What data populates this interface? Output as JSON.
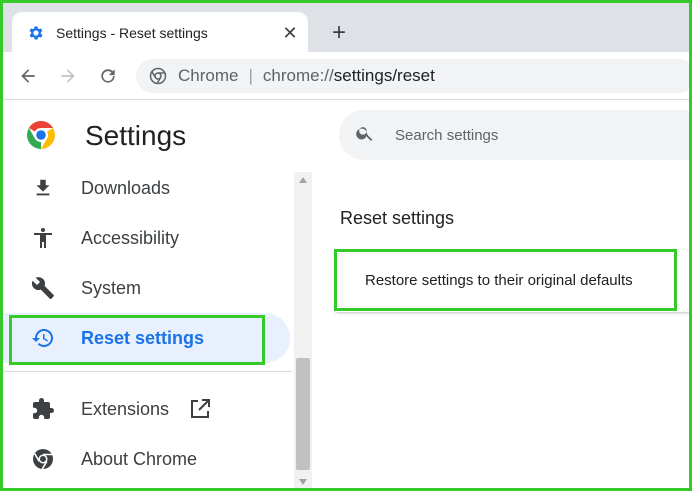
{
  "tab": {
    "title": "Settings - Reset settings",
    "close_glyph": "✕",
    "favicon": "gear-icon"
  },
  "new_tab_glyph": "+",
  "toolbar": {
    "site_name": "Chrome",
    "separator": "|",
    "url_scheme": "chrome://",
    "url_path": "settings/reset"
  },
  "sidebar": {
    "title": "Settings",
    "items": [
      {
        "label": "Downloads",
        "icon": "download-icon"
      },
      {
        "label": "Accessibility",
        "icon": "accessibility-icon"
      },
      {
        "label": "System",
        "icon": "wrench-icon"
      },
      {
        "label": "Reset settings",
        "icon": "restore-icon",
        "active": true
      },
      {
        "label": "Extensions",
        "icon": "puzzle-icon"
      },
      {
        "label": "About Chrome",
        "icon": "chrome-icon"
      }
    ]
  },
  "search": {
    "placeholder": "Search settings"
  },
  "main": {
    "section_title": "Reset settings",
    "card_label": "Restore settings to their original defaults"
  },
  "colors": {
    "accent": "#1a73e8",
    "highlight": "#36c92a",
    "active_bg": "#e8f0fe"
  }
}
